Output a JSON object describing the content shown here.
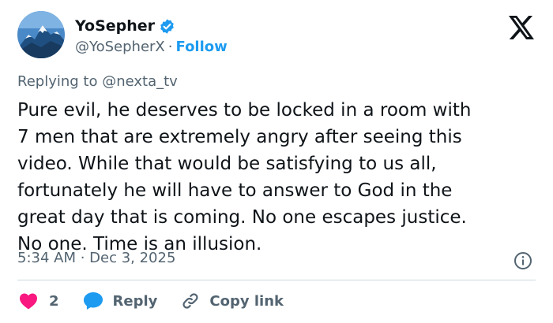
{
  "author": {
    "display_name": "YoSepher",
    "handle": "@YoSepherX",
    "separator": "·",
    "follow_label": "Follow",
    "verified": true
  },
  "reply_context": {
    "prefix": "Replying to ",
    "target": "@nexta_tv"
  },
  "tweet": {
    "lines": [
      "Pure evil, he deserves to be locked in a room with",
      "7 men that are extremely angry after seeing this",
      "video. While that would be satisfying to us all,",
      "fortunately he will have to answer to God in the",
      "great day that is coming. No one escapes justice.",
      "No one. Time is an illusion."
    ]
  },
  "meta": {
    "timestamp": "5:34 AM · Dec 3, 2025"
  },
  "actions": {
    "like_count": "2",
    "reply_label": "Reply",
    "copy_label": "Copy link"
  },
  "colors": {
    "accent": "#1d9bf0",
    "like": "#f91880",
    "muted": "#536471",
    "text": "#0f1419"
  },
  "icons": {
    "avatar": "mountain-avatar",
    "verified": "verified-badge-icon",
    "logo": "x-logo-icon",
    "info": "info-icon",
    "like": "heart-icon",
    "reply": "speech-bubble-icon",
    "copy": "link-icon"
  }
}
